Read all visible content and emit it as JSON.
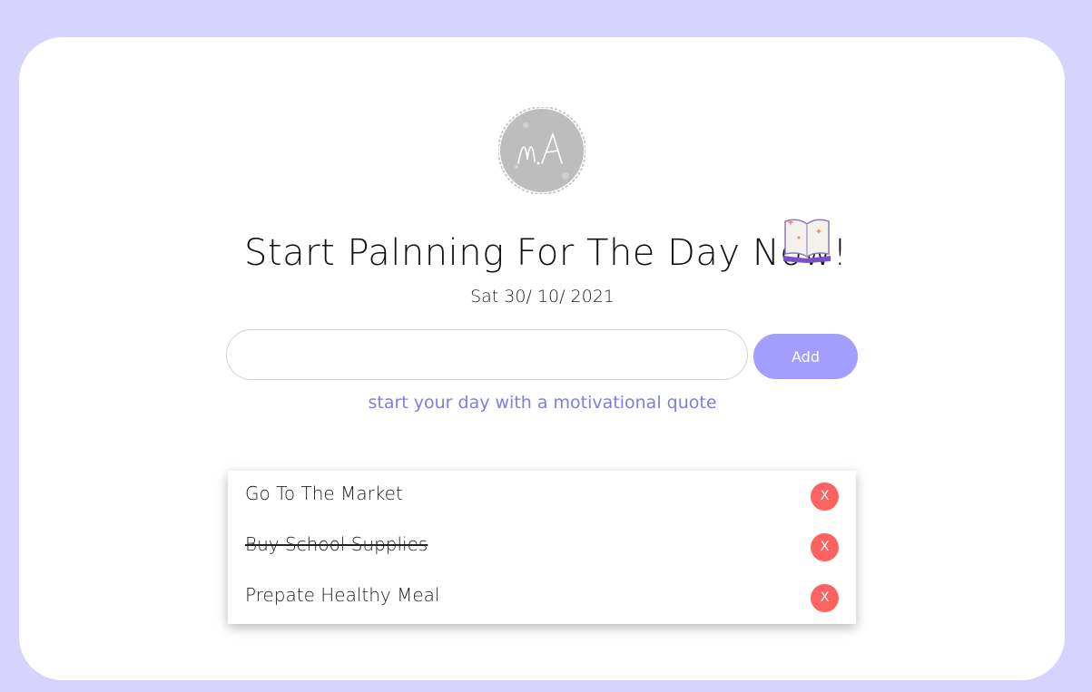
{
  "colors": {
    "page_background": "#d6d3ff",
    "card_background": "#ffffff",
    "accent": "#a19efe",
    "quote_link": "#7f7ce3",
    "delete": "#fb6361"
  },
  "logo": {
    "text": "mA",
    "icon": "brush-circle-logo"
  },
  "header": {
    "title": "Start Palnning For The Day Now!",
    "title_icon": "open-book-icon",
    "date": "Sat 30/ 10/ 2021"
  },
  "form": {
    "input_value": "",
    "add_label": "Add"
  },
  "quote": {
    "label": "start your day with a motivational quote"
  },
  "tasks": [
    {
      "text": "Go To The Market",
      "completed": false,
      "delete_label": "X"
    },
    {
      "text": "Buy School Supplies",
      "completed": true,
      "delete_label": "X"
    },
    {
      "text": "Prepate Healthy Meal",
      "completed": false,
      "delete_label": "X"
    }
  ]
}
